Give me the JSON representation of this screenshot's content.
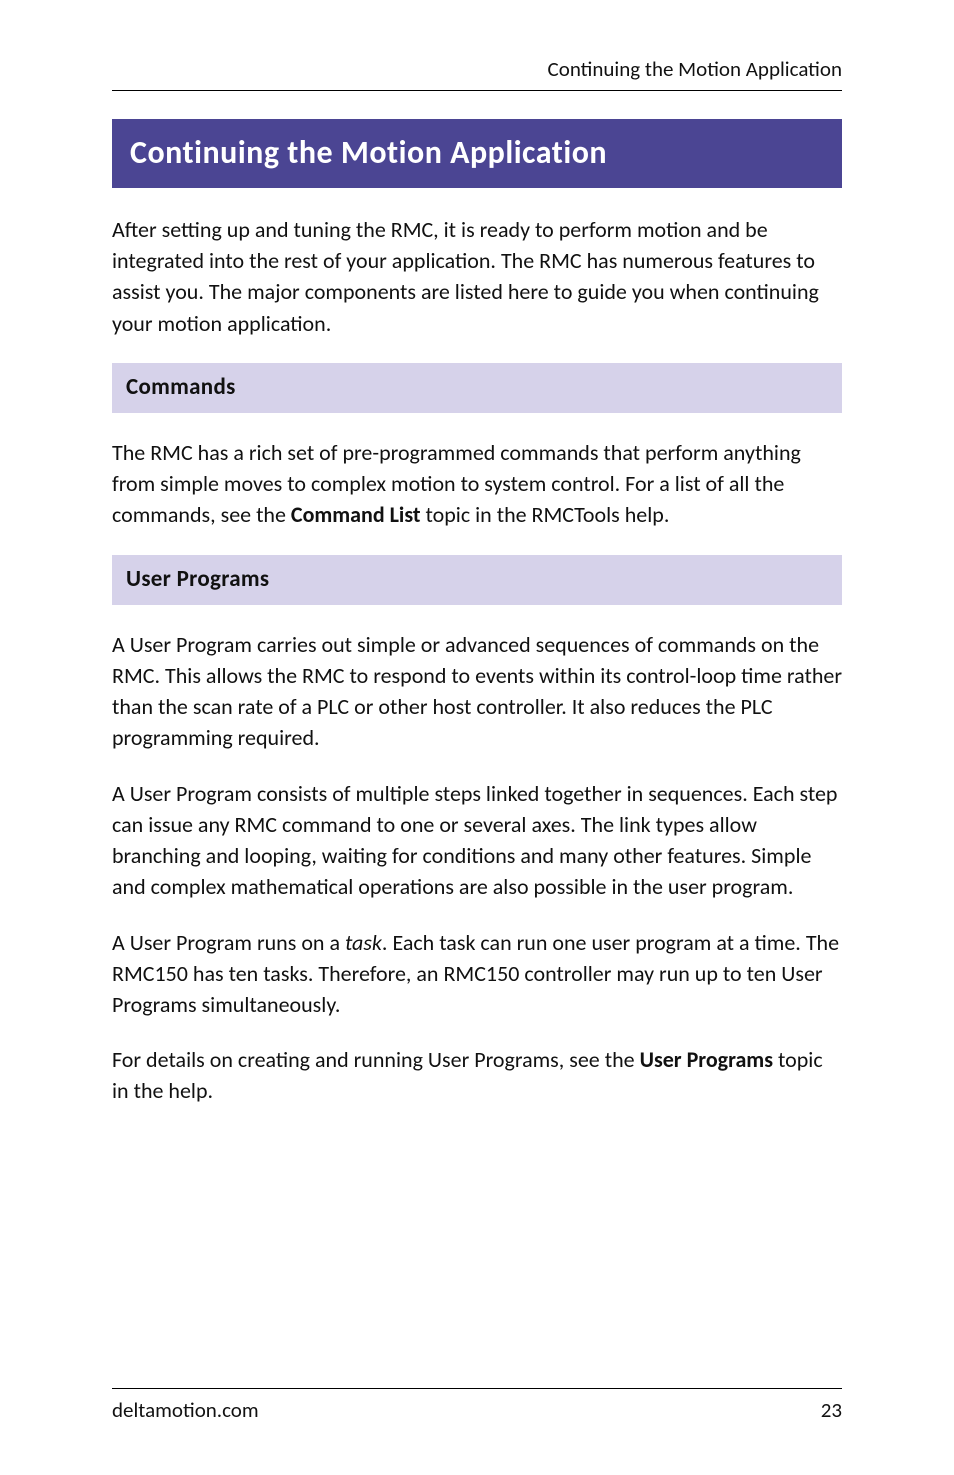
{
  "header": {
    "running_title": "Continuing the Motion Application"
  },
  "title": "Continuing the Motion Application",
  "intro": "After setting up and tuning the RMC, it is ready to perform motion and be integrated into the rest of your application. The RMC has numerous features to assist you. The major components are listed here to guide you when continuing your motion application.",
  "sections": {
    "commands": {
      "heading": "Commands",
      "p1_a": "The RMC has a rich set of pre-programmed commands that perform anything from simple moves to complex motion to system control. For a list of all the commands, see the ",
      "p1_bold": "Command List",
      "p1_b": " topic in the RMCTools help."
    },
    "user_programs": {
      "heading": "User Programs",
      "p1": "A User Program carries out simple or advanced sequences of commands on the RMC. This allows the RMC to respond to events within its control-loop time rather than the scan rate of a PLC or other host controller. It also reduces the PLC programming required.",
      "p2": "A User Program consists of multiple steps linked together in sequences. Each step can issue any RMC command to one or several axes. The link types allow branching and looping, waiting for conditions and many other features. Simple and complex mathematical operations are also possible in the user program.",
      "p3_a": "A User Program runs on a ",
      "p3_italic": "task",
      "p3_b": ". Each task can run one user program at a time. The RMC150 has ten tasks. Therefore, an RMC150 controller may run up to ten User Programs simultaneously.",
      "p4_a": "For details on creating and running User Programs, see the ",
      "p4_bold": "User Programs",
      "p4_b": " topic in the help."
    }
  },
  "footer": {
    "site": "deltamotion.com",
    "page": "23"
  }
}
